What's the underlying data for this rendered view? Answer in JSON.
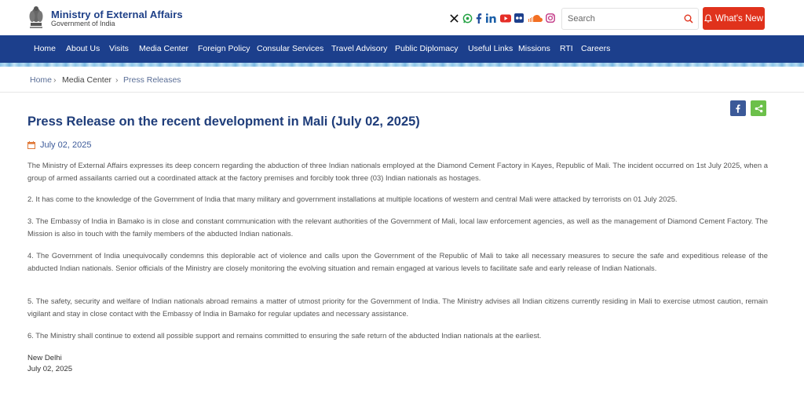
{
  "header": {
    "brand_title": "Ministry of External Affairs",
    "brand_subtitle": "Government of India",
    "search_placeholder": "Search",
    "whats_new": "What's New",
    "social_icons": [
      "x-icon",
      "whatsapp-icon",
      "facebook-icon",
      "linkedin-icon",
      "youtube-icon",
      "flickr-icon",
      "soundcloud-icon",
      "instagram-icon"
    ]
  },
  "nav": {
    "items": [
      "Home",
      "About Us",
      "Visits",
      "Media Center",
      "Foreign Policy",
      "Consular Services",
      "Travel Advisory",
      "Public Diplomacy",
      "Useful Links",
      "Missions",
      "RTI",
      "Careers"
    ]
  },
  "breadcrumb": {
    "items": [
      "Home",
      "Media Center",
      "Press Releases"
    ],
    "separator": "›"
  },
  "article": {
    "title": "Press Release on the recent development in Mali (July 02, 2025)",
    "date": "July 02, 2025",
    "paragraphs": [
      "The Ministry of External Affairs expresses its deep concern regarding the abduction of three Indian nationals employed at the Diamond Cement Factory in Kayes, Republic of Mali. The incident occurred on 1st July 2025, when a group of armed assailants carried out a coordinated attack at the factory premises and forcibly took three (03) Indian nationals as hostages.",
      "2. It has come to the knowledge of the Government of India that many military and government installations at multiple locations of western and central Mali were attacked by terrorists on 01 July 2025.",
      "3. The Embassy of India in Bamako is in close and constant communication with the relevant authorities of the Government of Mali, local law enforcement agencies, as well as the management of Diamond Cement Factory. The Mission is also in touch with the family members of the abducted Indian nationals.",
      "4. The Government of India unequivocally condemns this deplorable act of violence and calls upon the Government of the Republic of Mali to take all necessary measures to secure the safe and expeditious release of the abducted Indian nationals. Senior officials of the Ministry are closely monitoring the evolving situation and remain engaged at various levels to facilitate safe and early release of Indian Nationals.",
      "5. The safety, security and welfare of Indian nationals abroad remains a matter of utmost priority for the Government of India. The Ministry advises all Indian citizens currently residing in Mali to exercise utmost caution, remain vigilant and stay in close contact with the Embassy of India in Bamako for regular updates and necessary assistance.",
      "6. The Ministry shall continue to extend all possible support and remains committed to ensuring the safe return of the abducted Indian nationals at the earliest."
    ],
    "place": "New Delhi",
    "signoff_date": "July 02, 2025"
  },
  "colors": {
    "brand_blue": "#1d3f87",
    "nav_bg": "#1c3f8c",
    "whats_new_bg": "#e0321c",
    "share_facebook": "#3b5998",
    "share_generic": "#6cc04a"
  }
}
